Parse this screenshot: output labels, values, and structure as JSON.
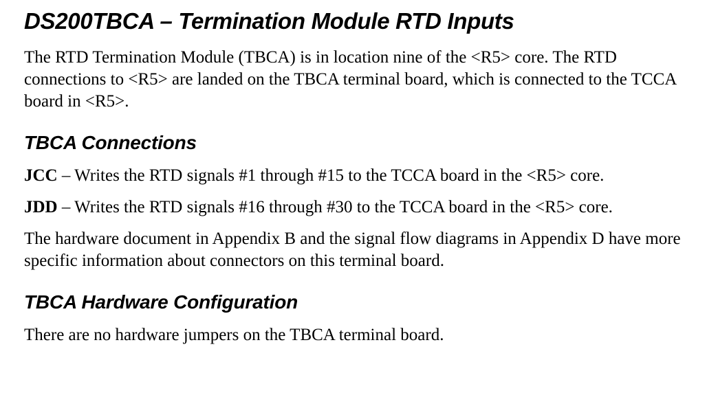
{
  "title": "DS200TBCA – Termination Module RTD Inputs",
  "intro": "The RTD Termination Module (TBCA) is in location nine of the <R5> core. The RTD connections to <R5> are landed on the TBCA terminal board, which is con­nected to the TCCA board in <R5>.",
  "section_connections": {
    "heading": "TBCA Connections",
    "jcc_label": "JCC",
    "jcc_text": " – Writes the RTD signals #1 through #15 to the TCCA board in the <R5> core.",
    "jdd_label": "JDD",
    "jdd_text": " – Writes the RTD signals #16 through #30 to the TCCA board in the <R5> core.",
    "appendix_text": "The hardware document in Appendix B and the signal flow diagrams in Appendix D have more specific information about connectors on this terminal board."
  },
  "section_hardware": {
    "heading": "TBCA Hardware Configuration",
    "text": "There are no hardware jumpers on the TBCA terminal board."
  }
}
